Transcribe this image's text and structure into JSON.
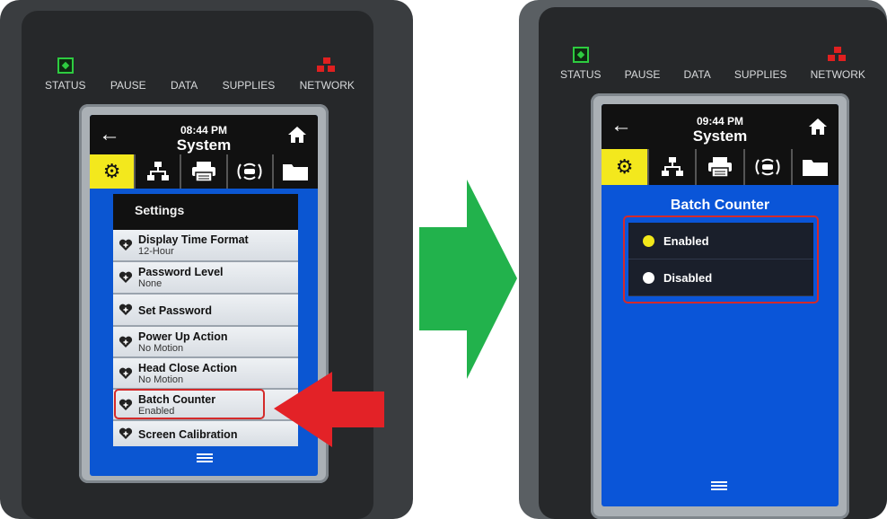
{
  "indicators": [
    "STATUS",
    "PAUSE",
    "DATA",
    "SUPPLIES",
    "NETWORK"
  ],
  "left_screen": {
    "time": "08:44 PM",
    "title": "System",
    "menu_header": "Settings",
    "items": [
      {
        "name": "Display Time Format",
        "value": "12-Hour"
      },
      {
        "name": "Password Level",
        "value": "None"
      },
      {
        "name": "Set Password",
        "value": ""
      },
      {
        "name": "Power Up Action",
        "value": "No Motion"
      },
      {
        "name": "Head Close Action",
        "value": "No Motion"
      },
      {
        "name": "Batch Counter",
        "value": "Enabled"
      },
      {
        "name": "Screen Calibration",
        "value": ""
      }
    ]
  },
  "right_screen": {
    "time": "09:44 PM",
    "title": "System",
    "page_title": "Batch Counter",
    "options": [
      {
        "label": "Enabled",
        "selected": true
      },
      {
        "label": "Disabled",
        "selected": false
      }
    ]
  },
  "colors": {
    "highlight": "#d42a2a",
    "arrow_red": "#e32227",
    "arrow_green": "#22b24c",
    "screen_blue": "#0a55d8",
    "tab_yellow": "#f3e81d"
  },
  "icons": [
    "back-arrow-icon",
    "home-icon",
    "gear-icon",
    "network-icon",
    "printer-icon",
    "wireless-icon",
    "folder-icon",
    "heart-plus-icon",
    "menu-icon"
  ]
}
